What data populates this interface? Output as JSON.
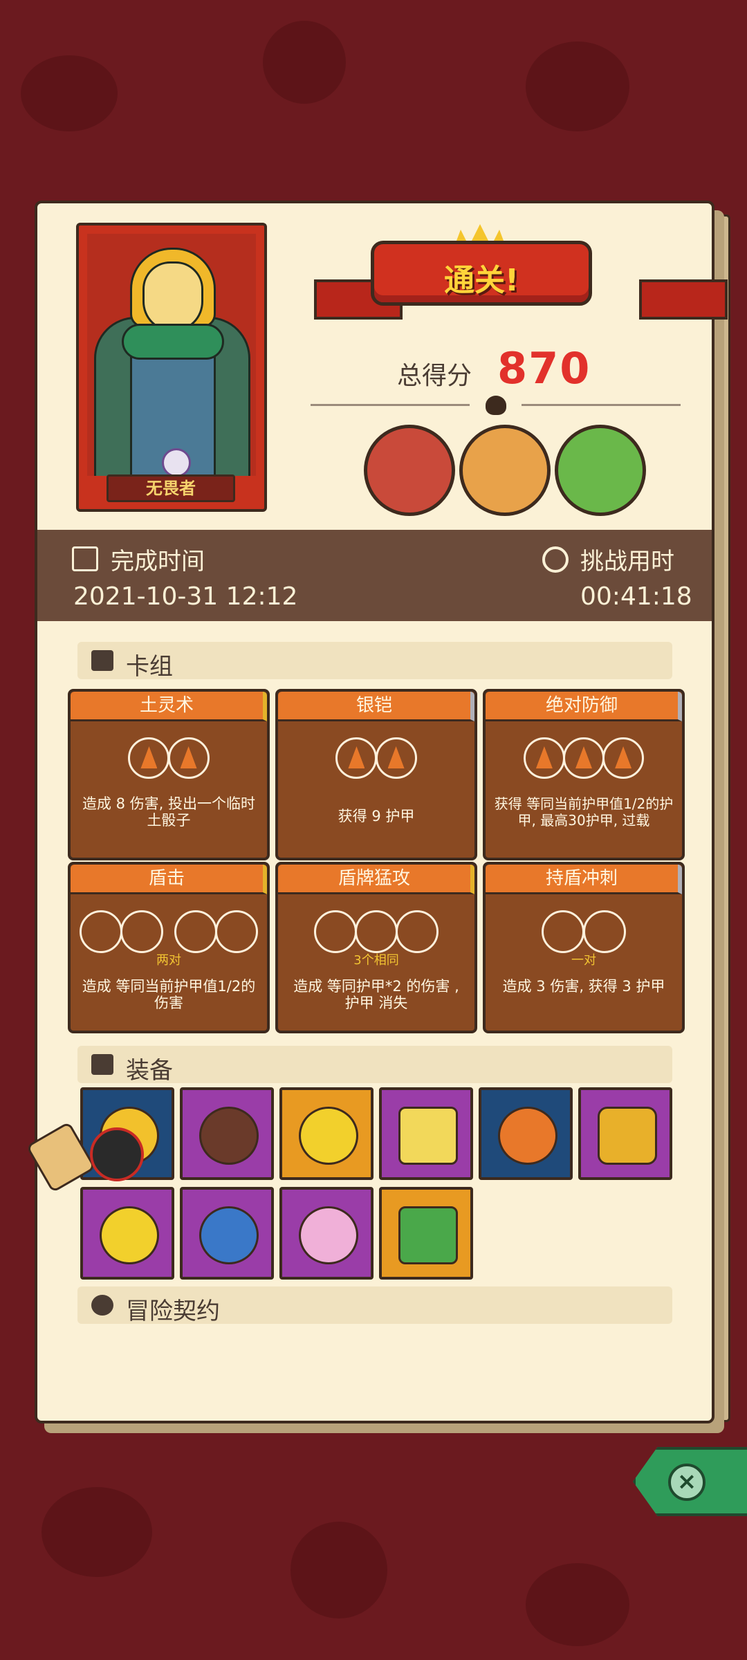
{
  "result": {
    "banner": "通关!",
    "score_label": "总得分",
    "score": "870",
    "hero_name": "无畏者"
  },
  "time": {
    "finish_label": "完成时间",
    "finish_value": "2021-10-31 12:12",
    "duration_label": "挑战用时",
    "duration_value": "00:41:18"
  },
  "deck": {
    "title": "卡组",
    "cards": [
      {
        "name": "土灵术",
        "slots": "2 fire",
        "note": "",
        "desc": "造成 8 伤害, 投出一个临时土骰子"
      },
      {
        "name": "银铠",
        "slots": "2 fire",
        "note": "",
        "desc": "获得 9 护甲"
      },
      {
        "name": "绝对防御",
        "slots": "3 fire",
        "note": "",
        "desc": "获得 等同当前护甲值1/2的护甲, 最高30护甲, 过载"
      },
      {
        "name": "盾击",
        "slots": "4 empty",
        "note": "两对",
        "desc": "造成 等同当前护甲值1/2的伤害"
      },
      {
        "name": "盾牌猛攻",
        "slots": "3 empty",
        "note": "3个相同",
        "desc": "造成 等同护甲*2 的伤害 , 护甲 消失"
      },
      {
        "name": "持盾冲刺",
        "slots": "2 empty",
        "note": "一对",
        "desc": "造成 3 伤害, 获得 3 护甲"
      }
    ]
  },
  "equipment": {
    "title": "装备",
    "items": [
      {
        "icon": "crown-helmet-icon",
        "color": "#1f4a7a"
      },
      {
        "icon": "button-icon",
        "color": "#9a3da8"
      },
      {
        "icon": "gold-coin-icon",
        "color": "#e89a22"
      },
      {
        "icon": "cheese-wedge-icon",
        "color": "#9a3da8"
      },
      {
        "icon": "turnip-pot-icon",
        "color": "#1f4a7a"
      },
      {
        "icon": "hex-gem-icon",
        "color": "#9a3da8"
      },
      {
        "icon": "green-ring-icon",
        "color": "#9a3da8"
      },
      {
        "icon": "demon-mask-icon",
        "color": "#9a3da8"
      },
      {
        "icon": "heart-locket-icon",
        "color": "#9a3da8"
      },
      {
        "icon": "green-slab-icon",
        "color": "#e89a22"
      }
    ]
  },
  "contract": {
    "title": "冒险契约"
  },
  "colors": {
    "background": "#6b1a1f",
    "panel": "#fbf1d6",
    "score": "#e2312b",
    "card": "#8a4a22",
    "card_header": "#e8782a"
  }
}
